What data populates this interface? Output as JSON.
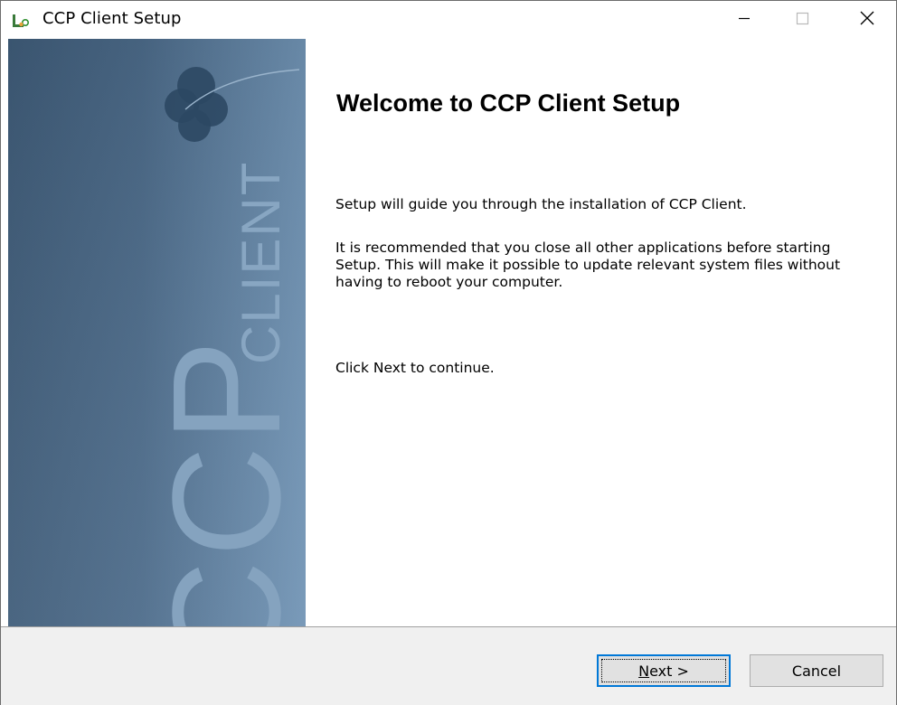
{
  "window": {
    "title": "CCP Client Setup",
    "icon": "installer-icon",
    "controls": {
      "minimize_icon": "minimize-icon",
      "maximize_icon": "maximize-icon",
      "close_icon": "close-icon"
    }
  },
  "banner": {
    "brand_large": "CCP",
    "brand_small": "CLIENT",
    "logo_icon": "globe-icon",
    "colors": {
      "gradient_dark": "#3c5a78",
      "gradient_light": "#6d8eae"
    }
  },
  "content": {
    "heading": "Welcome to CCP Client Setup",
    "paragraph_1": "Setup will guide you through the installation of CCP Client.",
    "paragraph_2": "It is recommended that you close all other applications before starting Setup. This will make it possible to update relevant system files without having to reboot your computer.",
    "paragraph_3": "Click Next to continue."
  },
  "footer": {
    "next_accel": "N",
    "next_rest": "ext >",
    "cancel_label": "Cancel",
    "colors": {
      "focus_border": "#0078d7"
    }
  }
}
